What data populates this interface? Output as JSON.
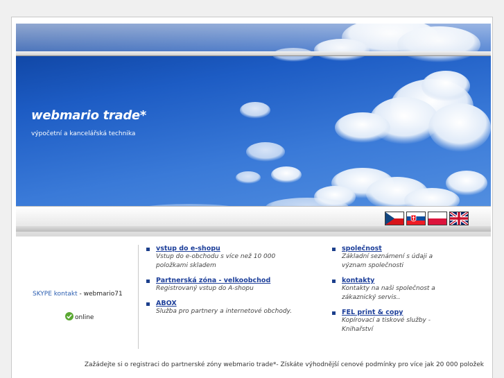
{
  "header": {
    "title": "webmario trade*",
    "subtitle": "výpočetní a kancelářská technika"
  },
  "languages": [
    {
      "code": "cz",
      "icon": "czech-flag-icon"
    },
    {
      "code": "sk",
      "icon": "slovak-flag-icon"
    },
    {
      "code": "pl",
      "icon": "polish-flag-icon"
    },
    {
      "code": "en",
      "icon": "uk-flag-icon"
    }
  ],
  "skype": {
    "link_label": "SKYPE kontakt",
    "separator": " - ",
    "username": "webmario71",
    "status": "online",
    "status_color": "#5aa832"
  },
  "left_menu": [
    {
      "label": "vstup do e-shopu",
      "desc": "Vstup do e-obchodu s více než 10 000 položkami skladem"
    },
    {
      "label": "Partnerská zóna - velkoobchod",
      "desc": "Registrovaný vstup do A-shopu"
    },
    {
      "label": "ABOX",
      "desc": "Služba pro partnery a internetové obchody."
    }
  ],
  "right_menu": [
    {
      "label": "společnost",
      "desc": "Základní seznámení s údaji a význam společnosti"
    },
    {
      "label": "kontakty",
      "desc": "Kontakty na naši společnost a zákaznický servis.."
    },
    {
      "label": "FEL print & copy",
      "desc": "Kopírovací a tiskové služby - Knihařství"
    }
  ],
  "footer": {
    "text": "Zažádejte si o registraci do partnerské zóny webmario trade*- Získáte výhodnější cenové podmínky pro více jak 20 000 položek"
  }
}
